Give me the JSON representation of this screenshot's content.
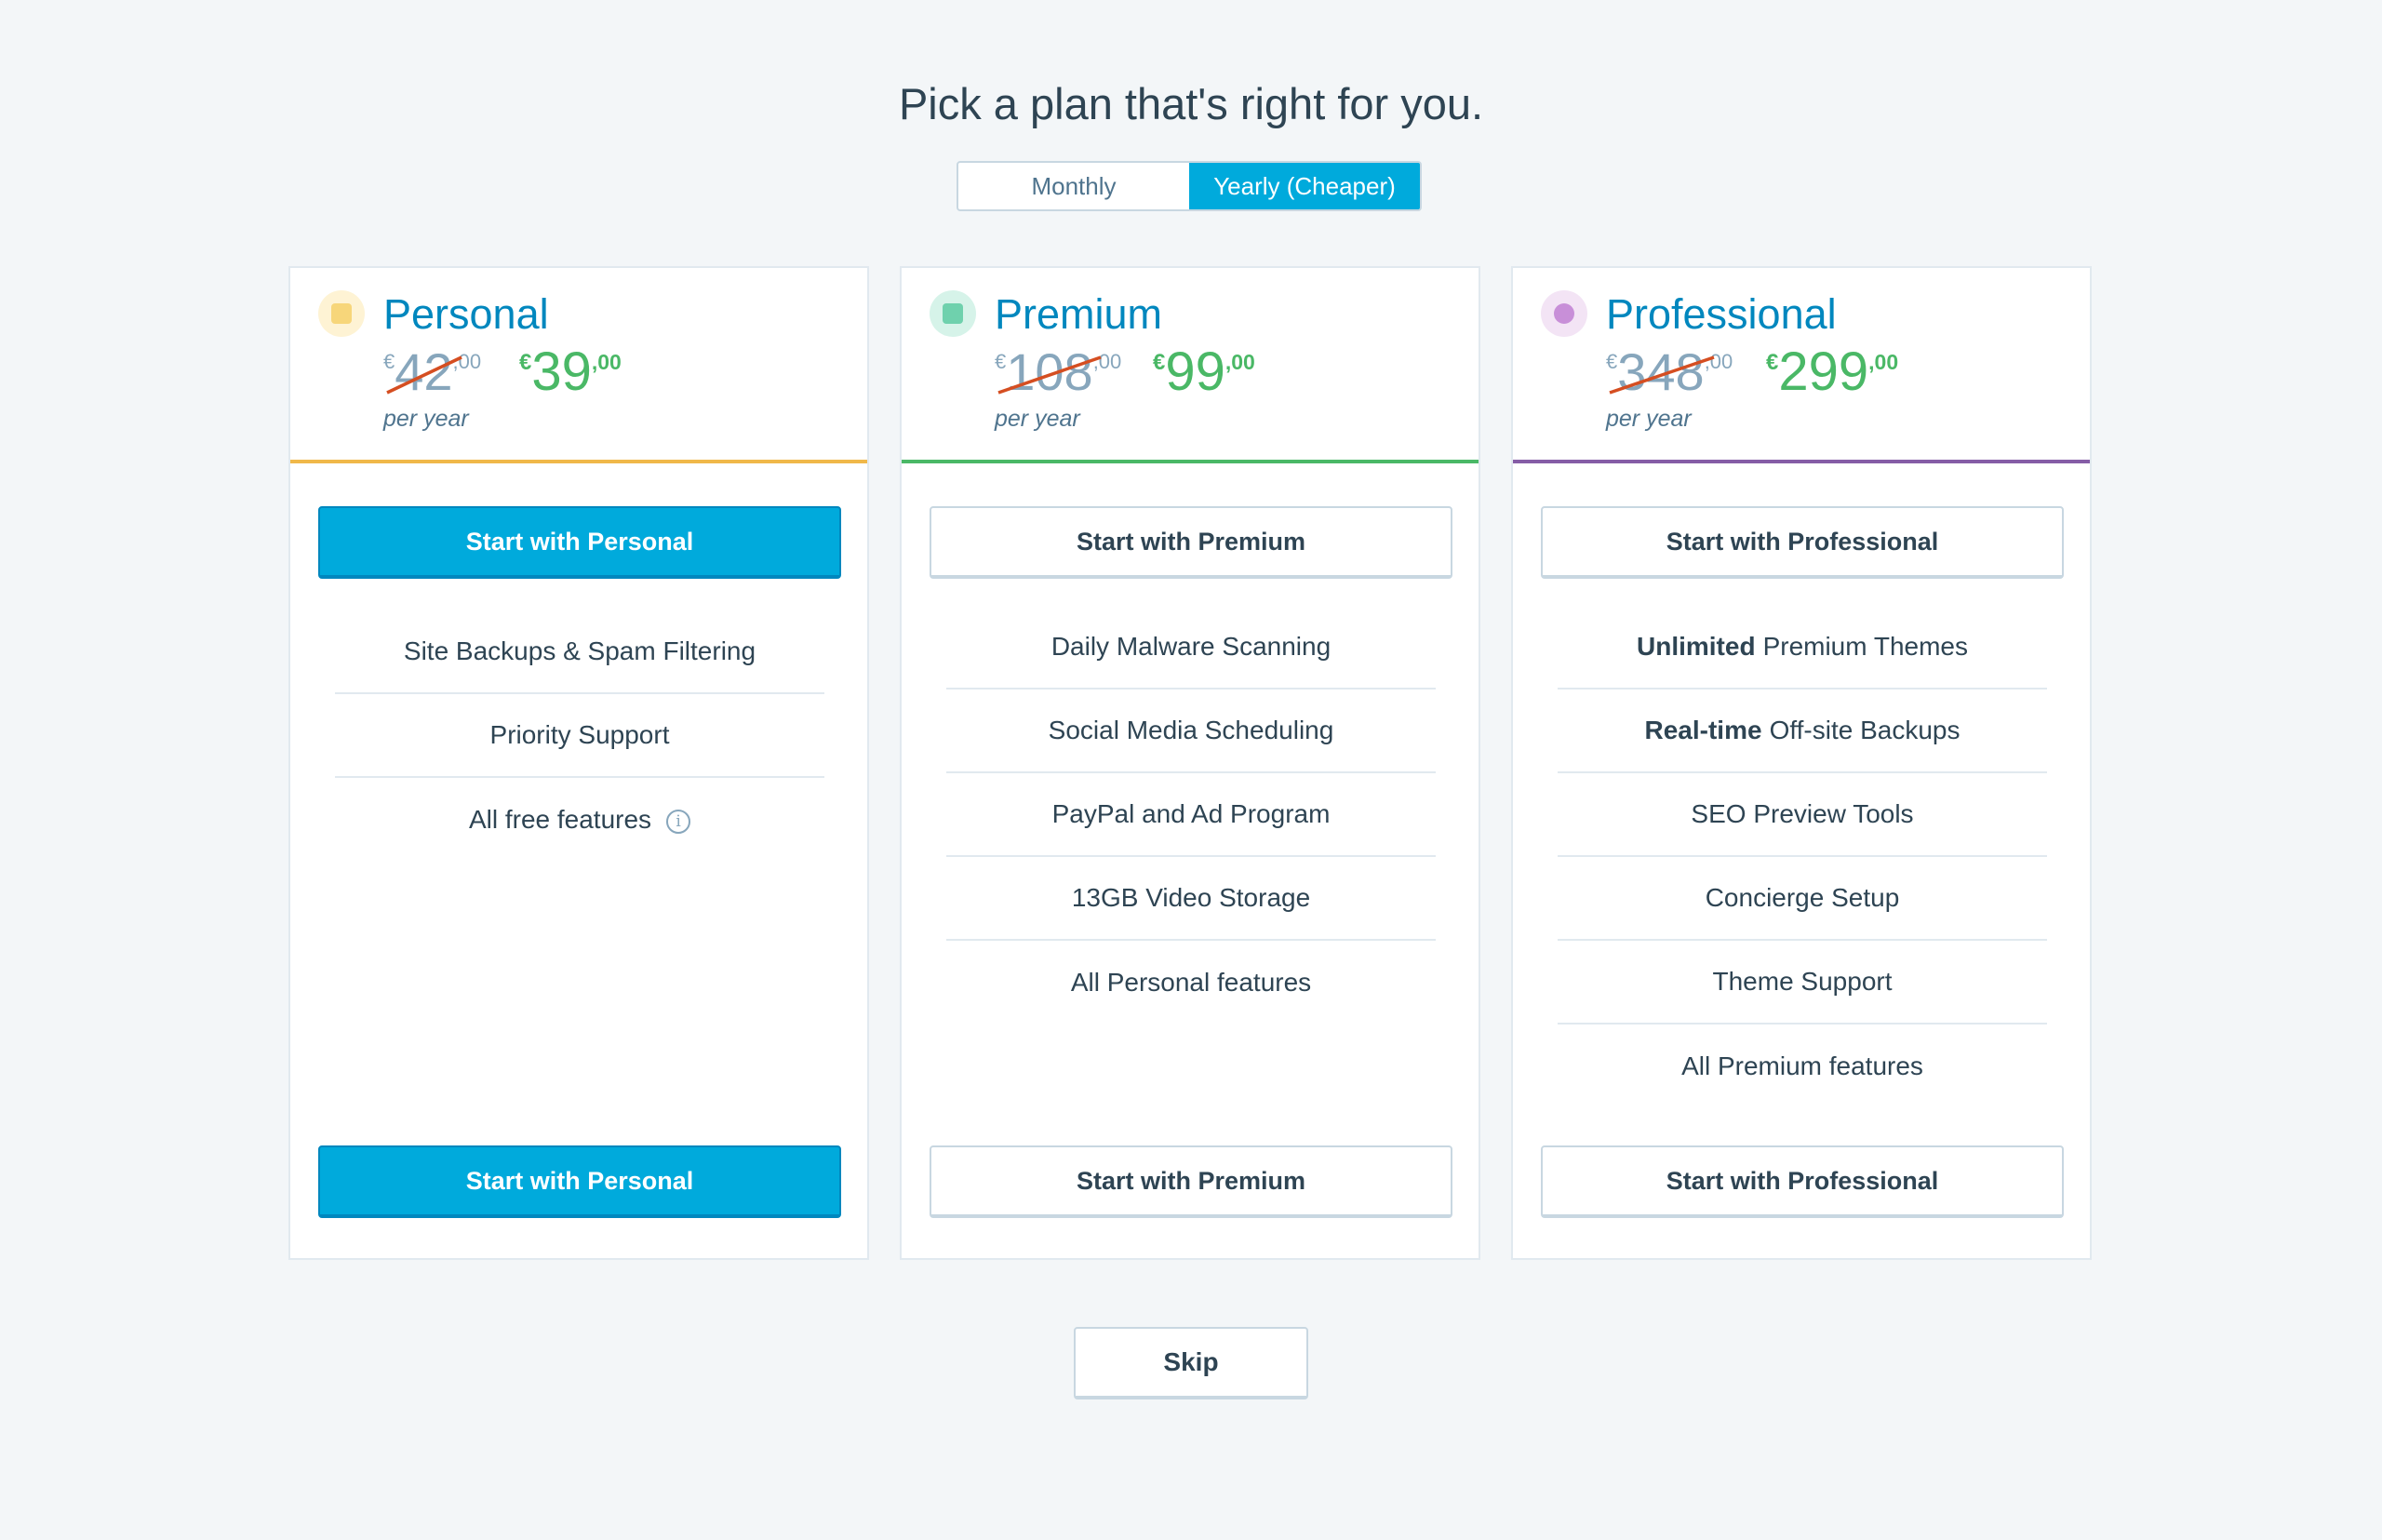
{
  "page": {
    "title": "Pick a plan that's right for you."
  },
  "billing_toggle": {
    "monthly": "Monthly",
    "yearly": "Yearly (Cheaper)",
    "selected": "yearly"
  },
  "plans": [
    {
      "name": "Personal",
      "accent": "#f0b849",
      "icon_bg": "#fef3d4",
      "icon": "personal-plan-icon",
      "old_price": {
        "currency": "€",
        "integer": "42",
        "decimal": ",00"
      },
      "new_price": {
        "currency": "€",
        "integer": "39",
        "decimal": ",00"
      },
      "period": "per year",
      "cta": "Start with Personal",
      "cta_style": "primary",
      "features": [
        {
          "bold": "",
          "text": "Site Backups & Spam Filtering"
        },
        {
          "bold": "",
          "text": "Priority Support"
        },
        {
          "bold": "",
          "text": "All free features"
        }
      ]
    },
    {
      "name": "Premium",
      "accent": "#4ab866",
      "icon_bg": "#d6f3e9",
      "icon": "premium-plan-icon",
      "old_price": {
        "currency": "€",
        "integer": "108",
        "decimal": ",00"
      },
      "new_price": {
        "currency": "€",
        "integer": "99",
        "decimal": ",00"
      },
      "period": "per year",
      "cta": "Start with Premium",
      "cta_style": "secondary",
      "features": [
        {
          "bold": "",
          "text": "Daily Malware Scanning"
        },
        {
          "bold": "",
          "text": "Social Media Scheduling"
        },
        {
          "bold": "",
          "text": "PayPal and Ad Program"
        },
        {
          "bold": "",
          "text": "13GB Video Storage"
        },
        {
          "bold": "",
          "text": "All Personal features"
        }
      ]
    },
    {
      "name": "Professional",
      "accent": "#855da6",
      "icon_bg": "#f3e4f5",
      "icon": "professional-plan-icon",
      "old_price": {
        "currency": "€",
        "integer": "348",
        "decimal": ",00"
      },
      "new_price": {
        "currency": "€",
        "integer": "299",
        "decimal": ",00"
      },
      "period": "per year",
      "cta": "Start with Professional",
      "cta_style": "secondary",
      "features": [
        {
          "bold": "Unlimited",
          "text": "Premium Themes"
        },
        {
          "bold": "Real-time",
          "text": "Off-site Backups"
        },
        {
          "bold": "",
          "text": "SEO Preview Tools"
        },
        {
          "bold": "",
          "text": "Concierge Setup"
        },
        {
          "bold": "",
          "text": "Theme Support"
        },
        {
          "bold": "",
          "text": "All Premium features"
        }
      ]
    }
  ],
  "skip": "Skip",
  "colors": {
    "primary": "#00aadc",
    "link": "#0087be",
    "sale": "#4ab866",
    "strike": "#d54e21"
  }
}
